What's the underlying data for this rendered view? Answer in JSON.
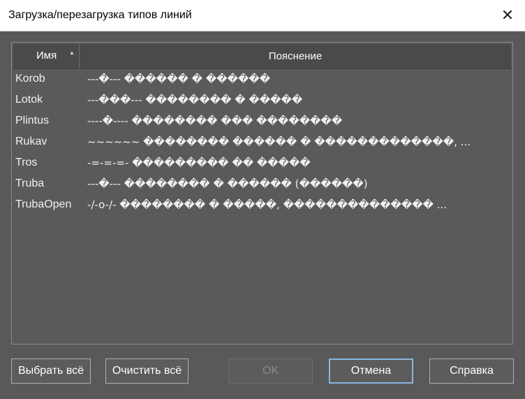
{
  "window": {
    "title": "Загрузка/перезагрузка типов линий",
    "close_glyph": "✕"
  },
  "table": {
    "columns": {
      "name": "Имя",
      "name_sort_glyph": "▲",
      "description": "Пояснение"
    },
    "rows": [
      {
        "name": "Korob",
        "description": "---�--- ������ � ������"
      },
      {
        "name": "Lotok",
        "description": "---���--- �������� � �����"
      },
      {
        "name": "Plintus",
        "description": "----�---- �������� ��� ��������"
      },
      {
        "name": "Rukav",
        "description": "~~~~~~ �������� ������ � �������������, ..."
      },
      {
        "name": "Tros",
        "description": "-=-=-=- ��������� �� �����"
      },
      {
        "name": "Truba",
        "description": "---�--- �������� � ������ (������)"
      },
      {
        "name": "TrubaOpen",
        "description": "-/-o-/- �������� � �����, �������������� ..."
      }
    ]
  },
  "buttons": {
    "select_all": "Выбрать всё",
    "clear_all": "Очистить всё",
    "ok": "OK",
    "cancel": "Отмена",
    "help": "Справка"
  }
}
